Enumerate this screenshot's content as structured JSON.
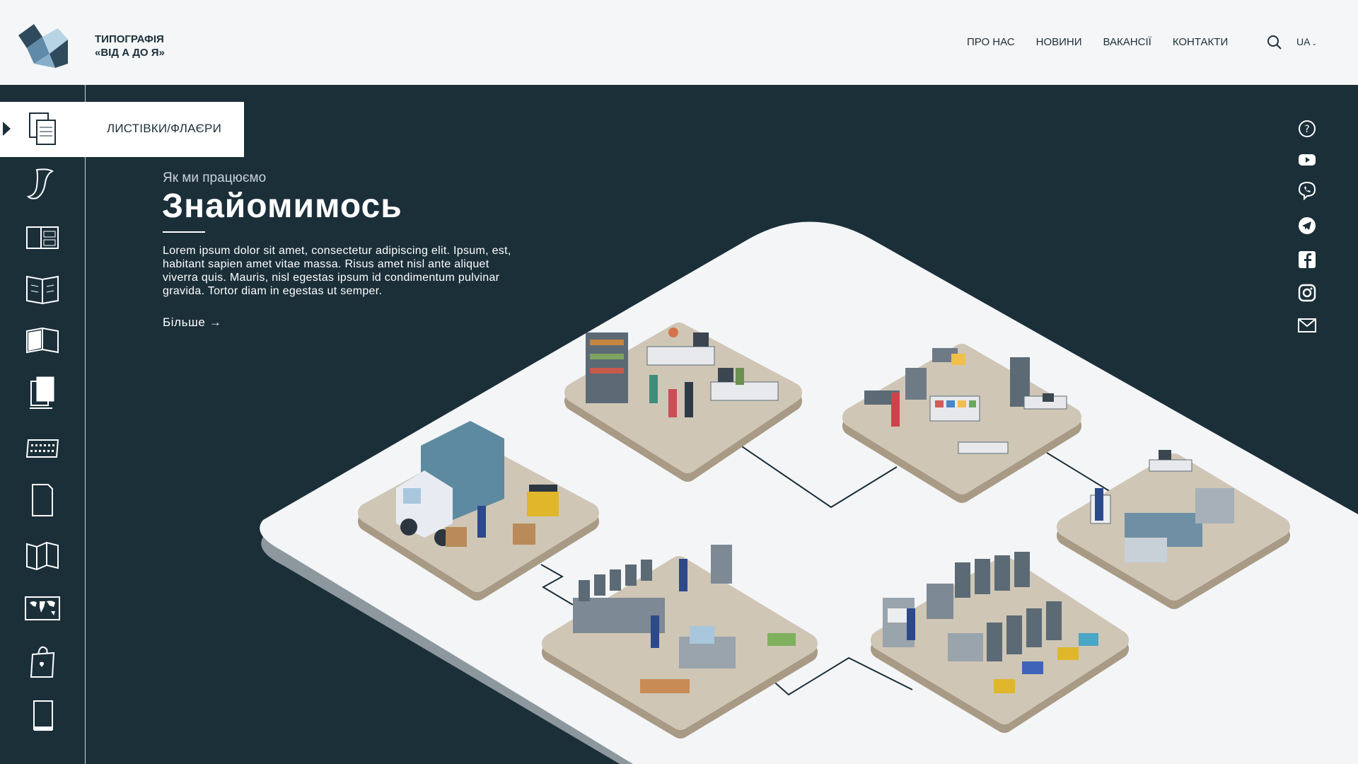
{
  "brand": {
    "line1": "ТИПОГРАФІЯ",
    "line2": "«ВІД А ДО Я»"
  },
  "nav": {
    "items": [
      {
        "label": "ПРО НАС"
      },
      {
        "label": "НОВИНИ"
      },
      {
        "label": "ВАКАНСІЇ"
      },
      {
        "label": "КОНТАКТИ"
      }
    ],
    "lang": "UA"
  },
  "sidebar": {
    "active_label": "ЛИСТІВКИ/ФЛАЄРИ",
    "items": [
      {
        "icon": "leaflet-icon"
      },
      {
        "icon": "scroll-icon"
      },
      {
        "icon": "brochure-icon"
      },
      {
        "icon": "magazine-icon"
      },
      {
        "icon": "book-icon"
      },
      {
        "icon": "notebook-stack-icon"
      },
      {
        "icon": "calendar-icon"
      },
      {
        "icon": "sheet-icon"
      },
      {
        "icon": "folded-flyer-icon"
      },
      {
        "icon": "world-map-icon"
      },
      {
        "icon": "shopping-bag-icon"
      },
      {
        "icon": "tablet-icon"
      }
    ]
  },
  "hero": {
    "eyebrow": "Як ми працюємо",
    "title": "Знайомимось",
    "body": "Lorem ipsum dolor sit amet, consectetur adipiscing elit. Ipsum, est, habitant sapien amet vitae massa.  Risus amet nisl ante aliquet viverra quis. Mauris, nisl egestas ipsum id condimentum pulvinar gravida. Tortor diam in egestas ut semper.",
    "more": "Більше →"
  },
  "social": [
    {
      "icon": "help-icon"
    },
    {
      "icon": "youtube-icon"
    },
    {
      "icon": "viber-icon"
    },
    {
      "icon": "telegram-icon"
    },
    {
      "icon": "facebook-icon"
    },
    {
      "icon": "instagram-icon"
    },
    {
      "icon": "mail-icon"
    }
  ],
  "colors": {
    "background": "#1b2f39",
    "header": "#f5f6f8",
    "platform": "#f2f4f6",
    "tile": "#cfc6b6"
  }
}
